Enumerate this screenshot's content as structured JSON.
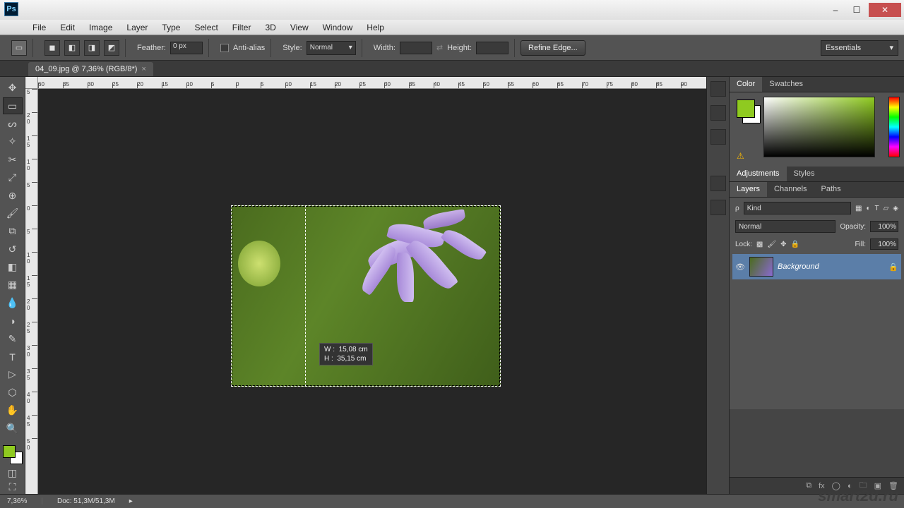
{
  "window": {
    "minimize": "–",
    "maximize": "☐",
    "close": "✕",
    "ps": "Ps"
  },
  "menu": [
    "File",
    "Edit",
    "Image",
    "Layer",
    "Type",
    "Select",
    "Filter",
    "3D",
    "View",
    "Window",
    "Help"
  ],
  "options": {
    "feather_label": "Feather:",
    "feather_value": "0 px",
    "antialias_label": "Anti-alias",
    "style_label": "Style:",
    "style_value": "Normal",
    "width_label": "Width:",
    "height_label": "Height:",
    "refine": "Refine Edge...",
    "workspace": "Essentials"
  },
  "tab": {
    "title": "04_09.jpg @ 7,36% (RGB/8*)",
    "close": "×"
  },
  "h_ruler_ticks": [
    "60",
    "35",
    "30",
    "25",
    "20",
    "15",
    "10",
    "5",
    "0",
    "5",
    "10",
    "15",
    "20",
    "25",
    "30",
    "35",
    "40",
    "45",
    "50",
    "55",
    "60",
    "65",
    "70",
    "75",
    "80",
    "85",
    "90"
  ],
  "v_ruler_ticks": [
    "5",
    "2\n0",
    "1\n5",
    "1\n0",
    "5",
    "0",
    "5",
    "1\n0",
    "1\n5",
    "2\n0",
    "2\n5",
    "3\n0",
    "3\n5",
    "4\n0",
    "4\n5",
    "5\n0"
  ],
  "tooltip": {
    "w_label": "W :",
    "w_val": "15,08 cm",
    "h_label": "H :",
    "h_val": "35,15 cm"
  },
  "watermark": "smart2d.ru",
  "panels": {
    "color_tabs": [
      "Color",
      "Swatches"
    ],
    "adj_tabs": [
      "Adjustments",
      "Styles"
    ],
    "layer_tabs": [
      "Layers",
      "Channels",
      "Paths"
    ],
    "kind_label": "Kind",
    "blend_mode": "Normal",
    "opacity_label": "Opacity:",
    "opacity_val": "100%",
    "lock_label": "Lock:",
    "fill_label": "Fill:",
    "fill_val": "100%",
    "layer_name": "Background"
  },
  "status": {
    "zoom": "7,36%",
    "doc": "Doc: 51,3M/51,3M"
  },
  "colors": {
    "fg": "#8fca20",
    "bg": "#ffffff",
    "selection_highlight": "#5b7ea8"
  }
}
